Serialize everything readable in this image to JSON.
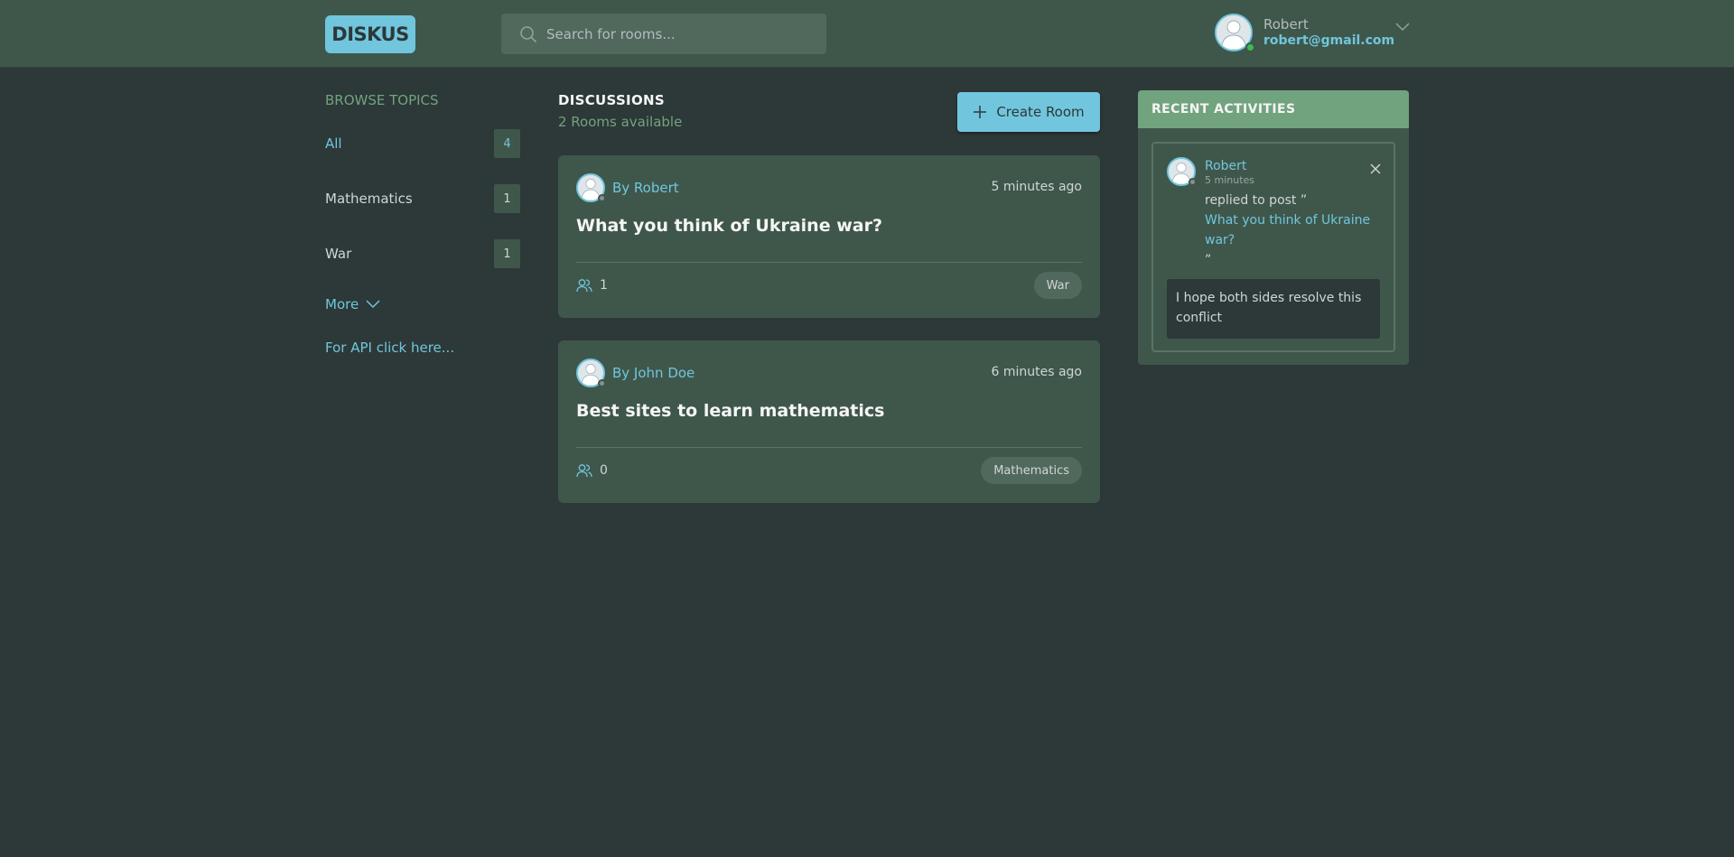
{
  "header": {
    "logo": "DISKUS",
    "search_placeholder": "Search for rooms...",
    "user": {
      "name": "Robert",
      "email": "robert@gmail.com",
      "status_color": "#3fb950"
    }
  },
  "sidebar": {
    "title": "BROWSE TOPICS",
    "topics": [
      {
        "label": "All",
        "count": "4"
      },
      {
        "label": "Mathematics",
        "count": "1"
      },
      {
        "label": "War",
        "count": "1"
      }
    ],
    "more": "More",
    "api_link": "For API click here..."
  },
  "main": {
    "title": "DISCUSSIONS",
    "subtitle": "2 Rooms available",
    "create_button": "Create Room",
    "rooms": [
      {
        "author": "By Robert",
        "time": "5 minutes ago",
        "title": "What you think of Ukraine war?",
        "participants": "1",
        "topic": "War"
      },
      {
        "author": "By John Doe",
        "time": "6 minutes ago",
        "title": "Best sites to learn mathematics",
        "participants": "0",
        "topic": "Mathematics"
      }
    ]
  },
  "activities": {
    "title": "RECENT ACTIVITIES",
    "items": [
      {
        "user": "Robert",
        "time": "5 minutes",
        "action": "replied to post ”",
        "post": "What you think of Ukraine war?",
        "close_quote": "”",
        "message": "I hope both sides resolve this conflict"
      }
    ]
  },
  "colors": {
    "background": "#2d3838",
    "panel": "#3f574b",
    "accent": "#71c6dd",
    "green_accent": "#71a37f"
  }
}
